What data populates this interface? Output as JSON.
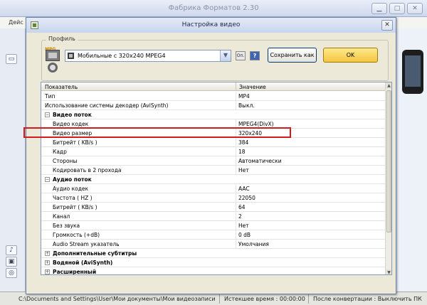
{
  "background": {
    "title": "Фабрика Форматов 2.30",
    "menu_item": "Дейс",
    "status": {
      "path": "C:\\Documents and Settings\\User\\Мои документы\\Мои видеозаписи",
      "time_label": "Истекшее время : 00:00:00",
      "after_label": "После конвертации : Выключить ПК"
    },
    "watermark_prefix": "B",
    "watermark_rest": "otvet.ru"
  },
  "dialog": {
    "title": "Настройка видео",
    "close_glyph": "✕",
    "profile": {
      "legend": "Профиль",
      "mpg_tag": "MPG",
      "selected": "Мобильные с 320х240 MPEG4",
      "options_button": "Оп.",
      "help_button": "?",
      "save_button": "Сохранить как",
      "ok_button": "OK"
    },
    "table": {
      "col_param": "Показатель",
      "col_value": "Значение",
      "rows": [
        {
          "name": "Тип",
          "value": "MP4"
        },
        {
          "name": "Использование системы декодер (AviSynth)",
          "value": "Выкл."
        },
        {
          "name": "Видео поток",
          "value": ""
        },
        {
          "name": "Видео кодек",
          "value": "MPEG4(DivX)"
        },
        {
          "name": "Видео размер",
          "value": "320x240"
        },
        {
          "name": "Битрейт ( KB/s )",
          "value": "384"
        },
        {
          "name": "Кадр",
          "value": "18"
        },
        {
          "name": "Стороны",
          "value": "Автоматически"
        },
        {
          "name": "Кодировать в 2 прохода",
          "value": "Нет"
        },
        {
          "name": "Аудио поток",
          "value": ""
        },
        {
          "name": "Аудио кодек",
          "value": "AAC"
        },
        {
          "name": "Частота ( HZ )",
          "value": "22050"
        },
        {
          "name": "Битрейт ( KB/s )",
          "value": "64"
        },
        {
          "name": "Канал",
          "value": "2"
        },
        {
          "name": "Без звука",
          "value": "Нет"
        },
        {
          "name": "Громкость (+dB)",
          "value": "0 dB"
        },
        {
          "name": "Audio Stream указатель",
          "value": "Умолчания"
        },
        {
          "name": "Дополнительные субтитры",
          "value": ""
        },
        {
          "name": "Водяной (AviSynth)",
          "value": ""
        },
        {
          "name": "Расширенный",
          "value": ""
        }
      ]
    }
  },
  "colors": {
    "highlight_border": "#d21b1b",
    "dialog_bg": "#ece9d8"
  },
  "icons": [
    "minimize-icon",
    "maximize-icon",
    "close-icon",
    "film-icon",
    "gear-icon",
    "chevron-down-icon",
    "expand-icon",
    "collapse-icon"
  ]
}
